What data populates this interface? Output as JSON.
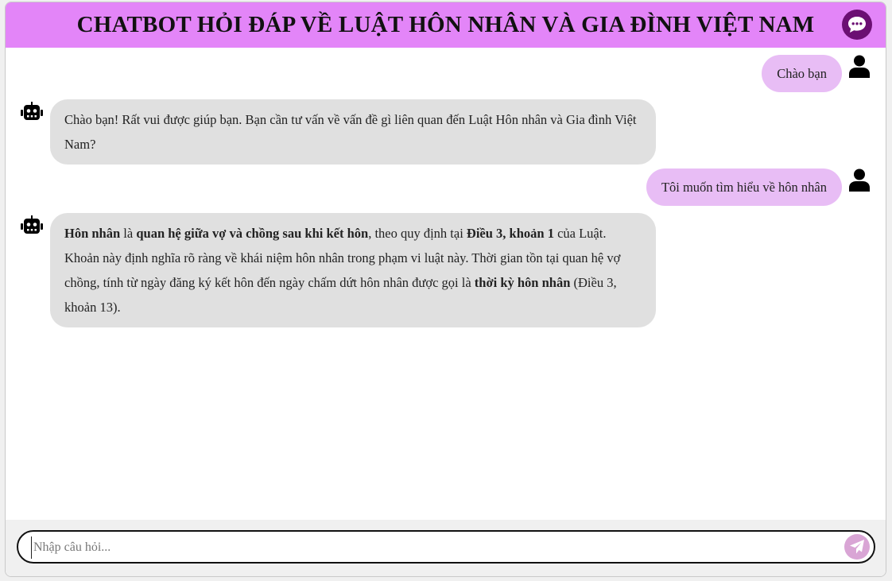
{
  "header": {
    "title": "CHATBOT HỎI ĐÁP VỀ LUẬT HÔN NHÂN VÀ GIA ĐÌNH VIỆT NAM",
    "icon": "chat-bubble-icon"
  },
  "messages": [
    {
      "role": "user",
      "text": "Chào bạn"
    },
    {
      "role": "bot",
      "text": "Chào bạn! Rất vui được giúp bạn. Bạn cần tư vấn về vấn đề gì liên quan đến Luật Hôn nhân và Gia đình Việt Nam?"
    },
    {
      "role": "user",
      "text": "Tôi muốn tìm hiểu về hôn nhân"
    },
    {
      "role": "bot",
      "segments": [
        {
          "t": "Hôn nhân",
          "b": true
        },
        {
          "t": " là ",
          "b": false
        },
        {
          "t": "quan hệ giữa vợ và chồng sau khi kết hôn",
          "b": true
        },
        {
          "t": ", theo quy định tại ",
          "b": false
        },
        {
          "t": "Điều 3, khoản 1",
          "b": true
        },
        {
          "t": " của Luật. Khoản này định nghĩa rõ ràng về khái niệm hôn nhân trong phạm vi luật này. Thời gian tồn tại quan hệ vợ chồng, tính từ ngày đăng ký kết hôn đến ngày chấm dứt hôn nhân được gọi là ",
          "b": false
        },
        {
          "t": "thời kỳ hôn nhân",
          "b": true
        },
        {
          "t": " (Điều 3, khoản 13).",
          "b": false
        }
      ]
    }
  ],
  "input": {
    "placeholder": "Nhập câu hỏi...",
    "value": ""
  },
  "colors": {
    "header": "#e385f8",
    "header_icon_bg": "#6b0f73",
    "user_bubble": "#e8bdf5",
    "bot_bubble": "#e0e0e0",
    "send_button": "#d9a5d5"
  }
}
